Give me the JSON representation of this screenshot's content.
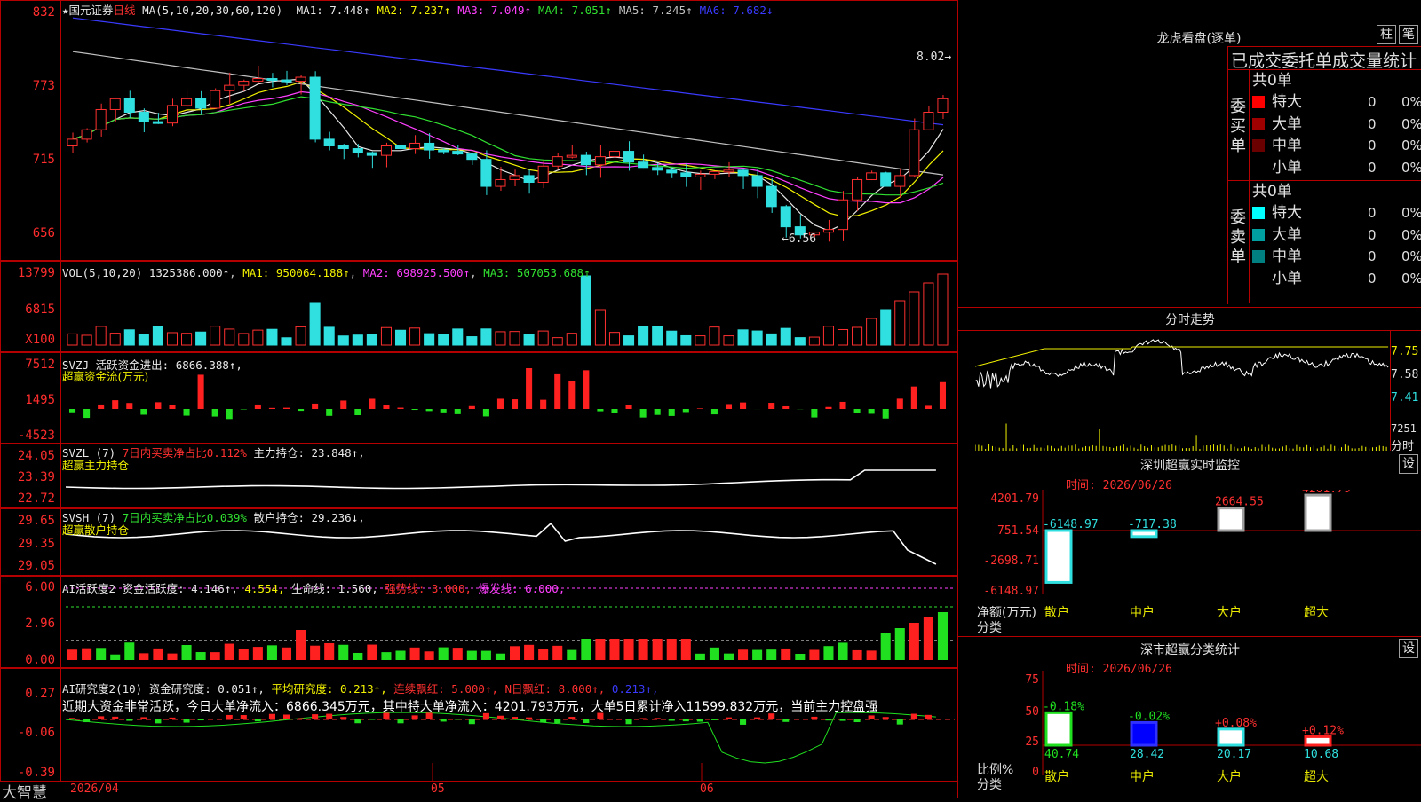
{
  "stock": {
    "name": "★国元证券",
    "period": "日线",
    "ma_def": "MA(5,10,20,30,60,120)"
  },
  "main_chart": {
    "y_ticks": [
      "832",
      "773",
      "715",
      "656"
    ],
    "ma": [
      {
        "label": "MA1: 7.448↑",
        "color": "#e8e8e8"
      },
      {
        "label": "MA2: 7.237↑",
        "color": "#f2f200"
      },
      {
        "label": "MA3: 7.049↑",
        "color": "#ff40ff"
      },
      {
        "label": "MA4: 7.051↑",
        "color": "#30e030"
      },
      {
        "label": "MA5: 7.245↑",
        "color": "#c0c0c0"
      },
      {
        "label": "MA6: 7.682↓",
        "color": "#3a3aff"
      }
    ],
    "high_label": "8.02",
    "low_label": "6.56"
  },
  "vol": {
    "header": "VOL(5,10,20)",
    "value": "1325386.000↑",
    "ma1": "MA1: 950064.188↑",
    "ma2": "MA2: 698925.500↑",
    "ma3": "MA3: 507053.688↑",
    "y_ticks": [
      "13799",
      "6815",
      "X100"
    ]
  },
  "svzj": {
    "header": "SVZJ",
    "label1": "活跃资金进出: 6866.388↑,",
    "label2": "超赢资金流(万元)",
    "y_ticks": [
      "7512",
      "1495",
      "-4523"
    ]
  },
  "svzl": {
    "header": "SVZL (7)",
    "label1": "7日内买卖净占比0.112%",
    "label2": "主力持仓: 23.848↑,",
    "label3": "超赢主力持仓",
    "y_ticks": [
      "24.05",
      "23.39",
      "22.72"
    ]
  },
  "svsh": {
    "header": "SVSH (7)",
    "label1": "7日内买卖净占比0.039%",
    "label2": "散户持仓: 29.236↓,",
    "label3": "超赢散户持仓",
    "y_ticks": [
      "29.65",
      "29.35",
      "29.05"
    ]
  },
  "ai_active": {
    "header": "AI活跃度2",
    "l1": "资金活跃度: 4.146↑,",
    "l2": "4.554,",
    "l3": "生命线: 1.560,",
    "l4": "强势线: 3.000,",
    "l5": "爆发线: 6.000,",
    "y_ticks": [
      "6.00",
      "2.96",
      "0.00"
    ]
  },
  "ai_research": {
    "header": "AI研究度2(10)",
    "l1": "资金研究度: 0.051↑,",
    "l2": "平均研究度: 0.213↑,",
    "l3": "连续飘红: 5.000↑,",
    "l4": "N日飘红: 8.000↑,",
    "l5": "0.213↑,",
    "note": "近期大资金非常活跃，今日大单净流入：6866.345万元，其中特大单净流入：4201.793万元，大单5日累计净入11599.832万元，当前主力控盘强",
    "y_ticks": [
      "0.27",
      "-0.06",
      "-0.39"
    ]
  },
  "x_axis": {
    "brand": "大智慧",
    "labels": [
      "2026/04",
      "05",
      "06"
    ]
  },
  "dragon": {
    "title": "龙虎看盘(逐单)",
    "btn1": "柱",
    "btn2": "笔",
    "subtitle": "已成交委托单成交量统计",
    "buy": {
      "side": "委买单",
      "total": "共0单",
      "rows": [
        {
          "name": "特大",
          "count": "0",
          "pct": "0%",
          "color": "#ff0000"
        },
        {
          "name": "大单",
          "count": "0",
          "pct": "0%",
          "color": "#a00000"
        },
        {
          "name": "中单",
          "count": "0",
          "pct": "0%",
          "color": "#6a0000"
        },
        {
          "name": "小单",
          "count": "0",
          "pct": "0%",
          "color": "#000000"
        }
      ]
    },
    "sell": {
      "side": "委卖单",
      "total": "共0单",
      "rows": [
        {
          "name": "特大",
          "count": "0",
          "pct": "0%",
          "color": "#00ffff"
        },
        {
          "name": "大单",
          "count": "0",
          "pct": "0%",
          "color": "#00a0a0"
        },
        {
          "name": "中单",
          "count": "0",
          "pct": "0%",
          "color": "#008080"
        },
        {
          "name": "小单",
          "count": "0",
          "pct": "0%",
          "color": "#000000"
        }
      ]
    }
  },
  "intraday": {
    "title": "分时走势",
    "y_ticks": [
      "7.75",
      "7.58",
      "7.41"
    ],
    "vol_top": "7251",
    "vol_unit": "分时"
  },
  "sz_monitor": {
    "title": "深圳超赢实时监控",
    "btn": "设",
    "time": "时间: 2026/06/26",
    "y_ticks": [
      "4201.79",
      "751.54",
      "-2698.71",
      "-6148.97"
    ],
    "unit": "净额(万元)",
    "cat_title": "分类",
    "chart_data": {
      "type": "bar",
      "categories": [
        "散户",
        "中户",
        "大户",
        "超大"
      ],
      "values": [
        -6148.97,
        -717.38,
        2664.55,
        4201.79
      ],
      "ylim": [
        -6148.97,
        4201.79
      ]
    }
  },
  "sz_class": {
    "title": "深市超赢分类统计",
    "btn": "设",
    "time": "时间: 2026/06/26",
    "y_ticks": [
      "75",
      "50",
      "25",
      "0"
    ],
    "unit": "比例%",
    "cat_title": "分类",
    "chart_data": {
      "type": "bar",
      "categories": [
        "散户",
        "中户",
        "大户",
        "超大"
      ],
      "values": [
        40.74,
        28.42,
        20.17,
        10.68
      ],
      "changes": [
        "-0.18%",
        "-0.02%",
        "+0.08%",
        "+0.12%"
      ],
      "ylim": [
        0,
        75
      ]
    }
  }
}
